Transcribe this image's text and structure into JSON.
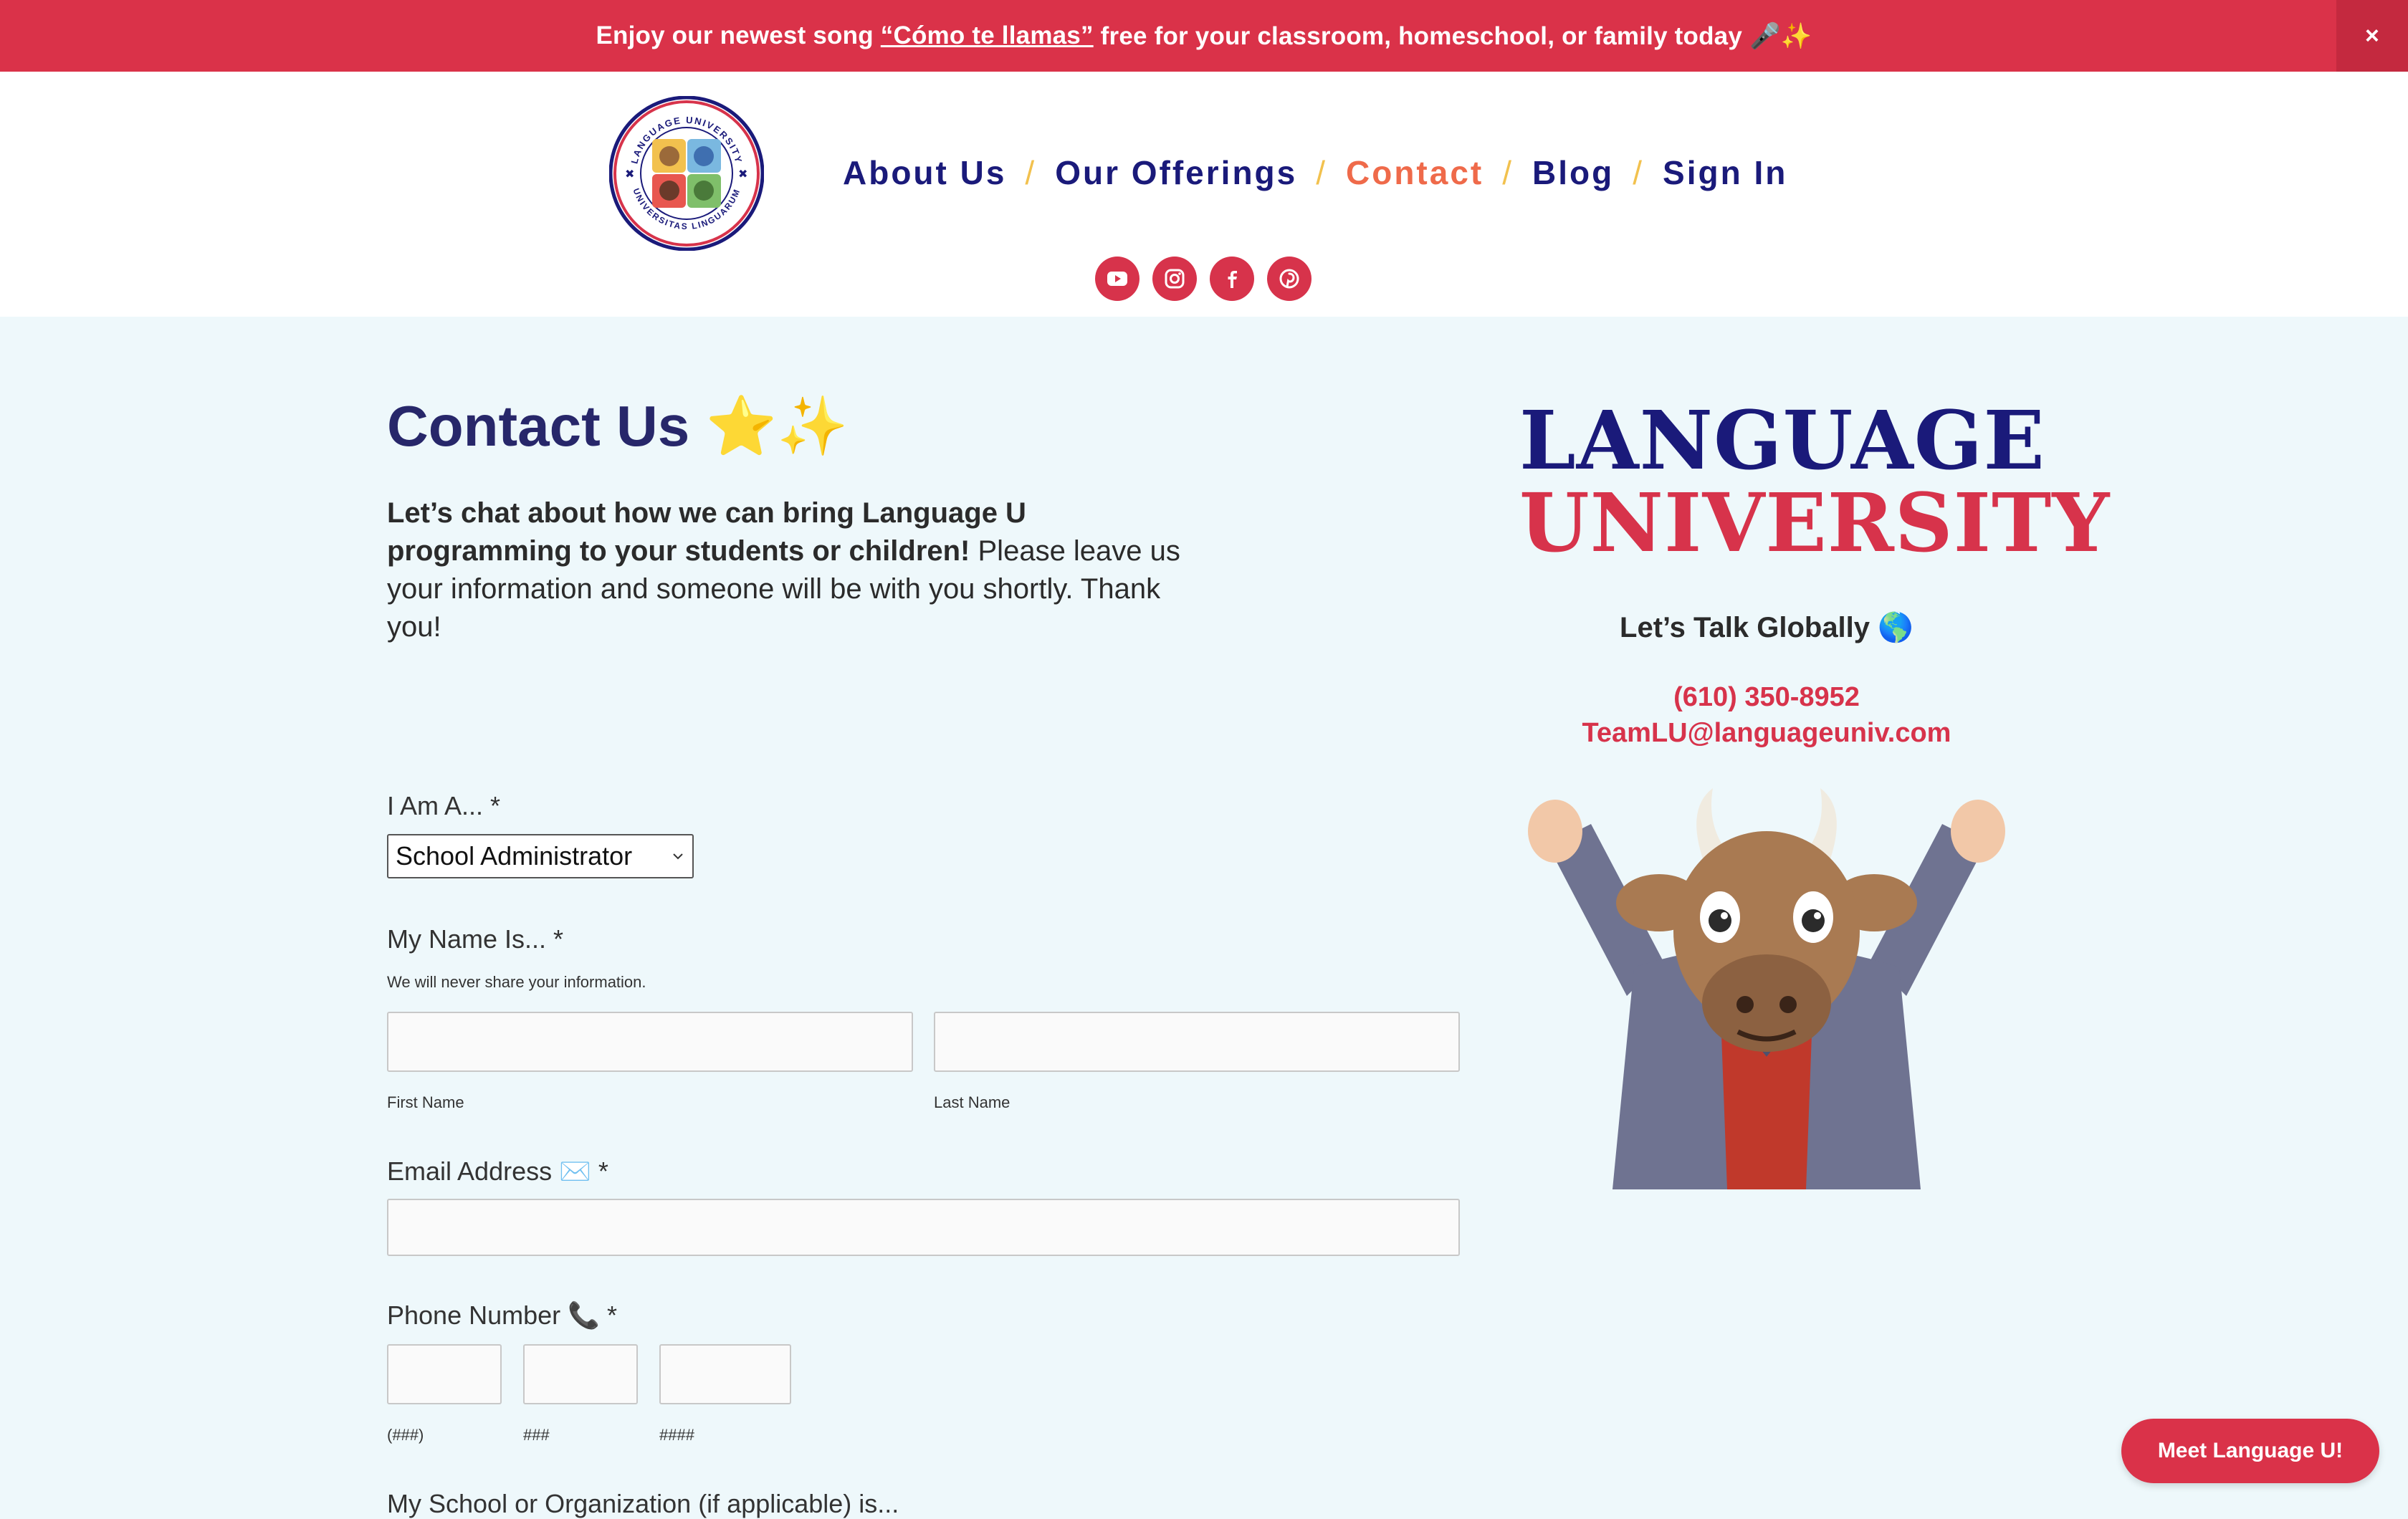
{
  "announcement": {
    "prefix": "Enjoy our newest song",
    "song_link": "“Cómo te llamas”",
    "suffix": "free for your classroom, homeschool, or family today 🎤✨",
    "close_label": "×"
  },
  "logo": {
    "top_text": "LANGUAGE UNIVERSITY",
    "bottom_text": "UNIVERSITAS LINGUARUM"
  },
  "nav": {
    "items": [
      {
        "label": "About Us",
        "active": false
      },
      {
        "label": "Our Offerings",
        "active": false
      },
      {
        "label": "Contact",
        "active": true
      },
      {
        "label": "Blog",
        "active": false
      },
      {
        "label": "Sign In",
        "active": false
      }
    ],
    "separator": "/"
  },
  "social": [
    "youtube-icon",
    "instagram-icon",
    "facebook-icon",
    "pinterest-icon"
  ],
  "contact": {
    "title": "Contact Us ⭐✨",
    "intro_bold": "Let’s chat about how we can bring Language U programming to your students or children!",
    "intro_rest": " Please leave us your information and someone will be with you shortly. Thank you!"
  },
  "form": {
    "role_label": "I Am A... *",
    "role_value": "School Administrator",
    "name_label": "My Name Is... *",
    "name_note": "We will never share your information.",
    "first_name_label": "First Name",
    "last_name_label": "Last Name",
    "email_label": "Email Address ✉️ *",
    "phone_label": "Phone Number 📞 *",
    "phone_hint_1": "(###)",
    "phone_hint_2": "###",
    "phone_hint_3": "####",
    "school_label": "My School or Organization (if applicable) is..."
  },
  "brand": {
    "line1": "LANGUAGE",
    "line2": "UNIVERSITY",
    "tagline": "Let’s Talk Globally 🌎",
    "phone": "(610) 350-8952",
    "email": "TeamLU@languageuniv.com"
  },
  "meet_button": "Meet Language U!",
  "colors": {
    "accent_red": "#da3249",
    "navy": "#1a1a7a",
    "active_orange": "#ef6a4a",
    "separator_gold": "#f2c14e",
    "background": "#eef8fb"
  }
}
